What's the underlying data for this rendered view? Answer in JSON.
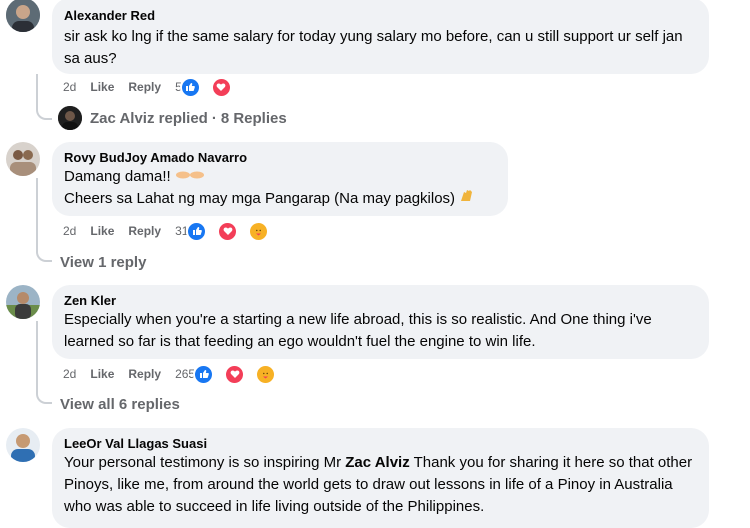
{
  "comments": [
    {
      "author": "Alexander Red",
      "text": "sir ask ko lng if the same salary for today yung salary mo before, can u still support ur self jan sa aus?",
      "time": "2d",
      "like_label": "Like",
      "reply_label": "Reply",
      "reaction_count": "5",
      "replies_summary": {
        "replier": "Zac Alviz replied",
        "sep": "·",
        "count": "8 Replies"
      }
    },
    {
      "author": "Rovy BudJoy Amado Navarro",
      "line1": "Damang dama!!",
      "line2": "Cheers sa Lahat ng may mga Pangarap (Na may pagkilos)",
      "time": "2d",
      "like_label": "Like",
      "reply_label": "Reply",
      "reaction_count": "31",
      "view_replies": "View 1 reply"
    },
    {
      "author": "Zen Kler",
      "text": "Especially when you're a starting a new life abroad, this is so realistic. And One thing i've learned so far is that feeding an ego wouldn't fuel the engine to win life.",
      "time": "2d",
      "like_label": "Like",
      "reply_label": "Reply",
      "reaction_count": "265",
      "view_replies": "View all 6 replies"
    },
    {
      "author": "LeeOr Val Llagas Suasi",
      "text_before": "Your personal testimony is so inspiring Mr ",
      "mention": "Zac Alviz",
      "text_after": " Thank you for sharing it here so that other Pinoys, like me, from around the world gets to draw out lessons in life of a Pinoy in Australia who was able to succeed in life living outside of the Philippines."
    }
  ],
  "icons": {
    "like": "like-reaction-icon",
    "love": "heart-reaction-icon",
    "care": "care-reaction-icon"
  },
  "colors": {
    "bubble": "#f0f2f5",
    "meta": "#65676b",
    "like_blue": "#1877f2",
    "love_red": "#f33e58"
  }
}
